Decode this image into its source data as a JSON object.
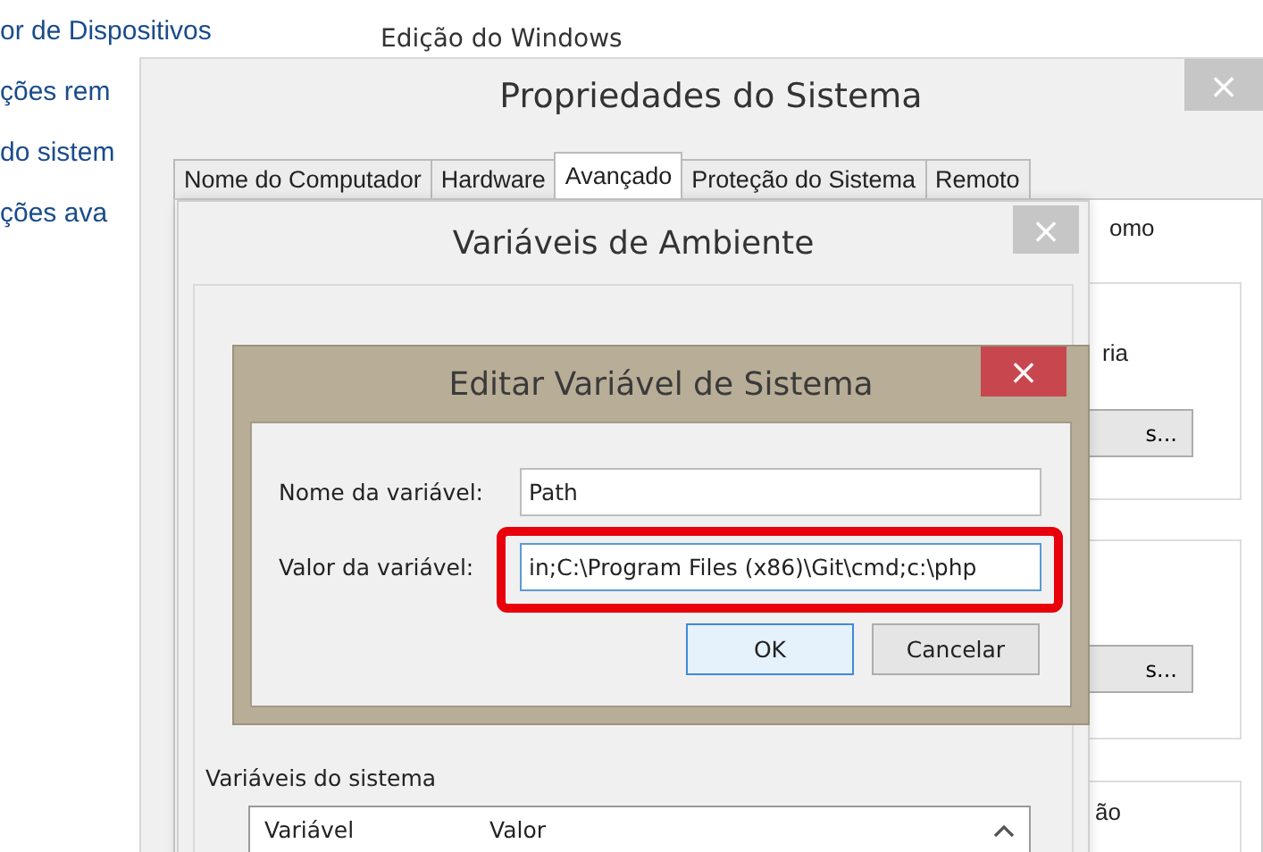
{
  "background": {
    "sidebar_items": [
      "or de Dispositivos",
      "ções rem",
      "do sistem",
      "ções ava"
    ],
    "heading": "Edição do Windows"
  },
  "system_properties": {
    "title": "Propriedades do Sistema",
    "close": "×",
    "tabs": [
      {
        "label": "Nome do Computador",
        "selected": false
      },
      {
        "label": "Hardware",
        "selected": false
      },
      {
        "label": "Avançado",
        "selected": true
      },
      {
        "label": "Proteção do Sistema",
        "selected": false
      },
      {
        "label": "Remoto",
        "selected": false
      }
    ],
    "panel_items": [
      {
        "kind": "text",
        "text": "omo"
      },
      {
        "kind": "text",
        "text": "ria"
      },
      {
        "kind": "button",
        "text": "s..."
      },
      {
        "kind": "button",
        "text": "s..."
      },
      {
        "kind": "text",
        "text": "ão"
      }
    ]
  },
  "environment_variables": {
    "title": "Variáveis de Ambiente",
    "close": "×",
    "system_group": {
      "label": "Variáveis do sistema",
      "columns": [
        "Variável",
        "Valor"
      ]
    }
  },
  "edit_dialog": {
    "title": "Editar Variável de Sistema",
    "close": "×",
    "fields": [
      {
        "label": "Nome da variável:",
        "value": "Path",
        "focused": false,
        "highlighted": false
      },
      {
        "label": "Valor da variável:",
        "value": "in;C:\\Program Files (x86)\\Git\\cmd;c:\\php",
        "focused": true,
        "highlighted": true
      }
    ],
    "buttons": [
      {
        "label": "OK",
        "default": true
      },
      {
        "label": "Cancelar",
        "default": false
      }
    ]
  }
}
